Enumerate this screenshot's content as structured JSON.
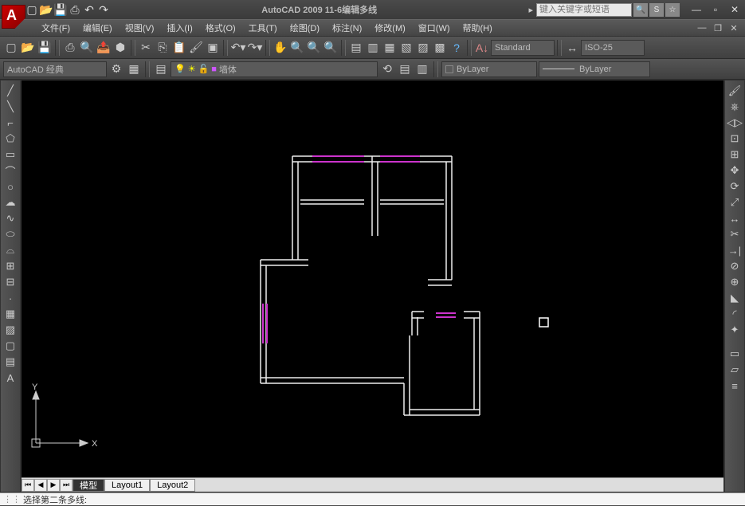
{
  "title": "AutoCAD 2009 11-6编辑多线",
  "search_placeholder": "键入关键字或短语",
  "menu": [
    "文件(F)",
    "编辑(E)",
    "视图(V)",
    "插入(I)",
    "格式(O)",
    "工具(T)",
    "绘图(D)",
    "标注(N)",
    "修改(M)",
    "窗口(W)",
    "帮助(H)"
  ],
  "style_std": "Standard",
  "dim_style": "ISO-25",
  "workspace": "AutoCAD 经典",
  "layer_name": "墙体",
  "linetype": "ByLayer",
  "lineweight": "ByLayer",
  "tabs": {
    "model": "模型",
    "layout1": "Layout1",
    "layout2": "Layout2"
  },
  "command_prompt": "选择第二条多线:",
  "axis": {
    "x": "X",
    "y": "Y"
  }
}
